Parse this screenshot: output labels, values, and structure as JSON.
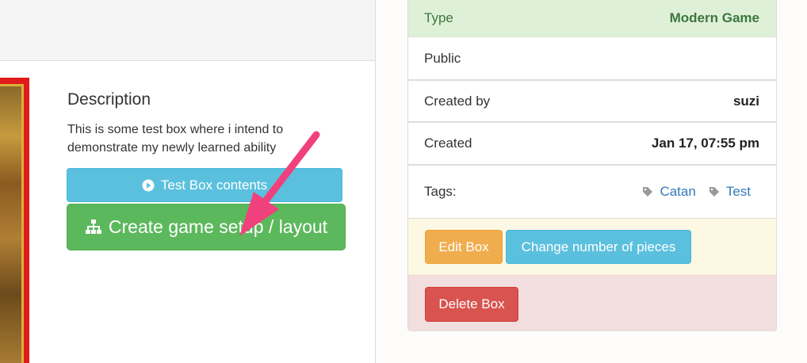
{
  "description": {
    "heading": "Description",
    "text": "This is some test box where i intend to demonstrate my newly learned ability"
  },
  "buttons": {
    "test_contents": "Test Box contents",
    "create_setup": "Create game setup / layout"
  },
  "info": {
    "type_label": "Type",
    "type_value": "Modern Game",
    "public_label": "Public",
    "created_by_label": "Created by",
    "created_by_value": "suzi",
    "created_label": "Created",
    "created_value": "Jan 17, 07:55 pm",
    "tags_label": "Tags:",
    "tags": [
      "Catan",
      "Test"
    ]
  },
  "actions": {
    "edit": "Edit Box",
    "change_pieces": "Change number of pieces",
    "delete": "Delete Box"
  },
  "colors": {
    "success": "#5cb85c",
    "info": "#5bc0de",
    "warning": "#f0ad4e",
    "danger": "#d9534f",
    "annotation_arrow": "#f0417d"
  },
  "icons": {
    "test_contents": "play-circle-icon",
    "create_setup": "sitemap-icon",
    "tag": "tag-icon"
  }
}
